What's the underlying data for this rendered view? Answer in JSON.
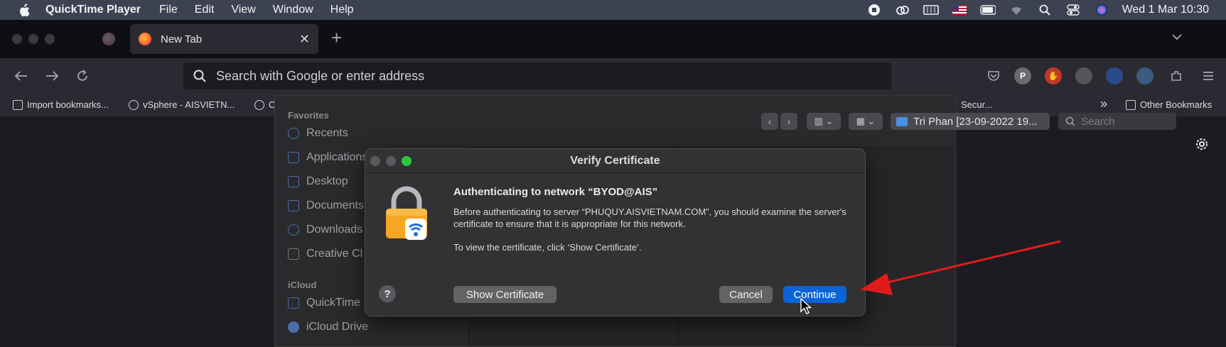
{
  "menubar": {
    "app_name": "QuickTime Player",
    "menus": [
      "File",
      "Edit",
      "View",
      "Window",
      "Help"
    ],
    "clock": "Wed 1 Mar  10:30"
  },
  "browser": {
    "tab_title": "New Tab",
    "new_tab_symbol": "+",
    "close_symbol": "✕",
    "url_placeholder": "Search with Google or enter address",
    "bookmarks": {
      "import": "Import bookmarks...",
      "vsphere": "vSphere - AISVIETN...",
      "c": "C",
      "secur": "Secur...",
      "chevrons": "»",
      "other": "Other Bookmarks"
    }
  },
  "finder": {
    "favorites_heading": "Favorites",
    "favorites": [
      "Recents",
      "Applications",
      "Desktop",
      "Documents",
      "Downloads",
      "Creative Cl"
    ],
    "icloud_heading": "iCloud",
    "icloud": [
      "QuickTime",
      "iCloud Drive"
    ],
    "location": "Tri Phan [23-09-2022 19...",
    "search_placeholder": "Search"
  },
  "dialog": {
    "title": "Verify Certificate",
    "heading": "Authenticating to network “BYOD@AIS”",
    "body1": "Before authenticating to server “PHUQUY.AISVIETNAM.COM”, you should examine the server's certificate to ensure that it is appropriate for this network.",
    "body2": "To view the certificate, click ‘Show Certificate’.",
    "help_label": "?",
    "show_certificate": "Show Certificate",
    "cancel": "Cancel",
    "continue": "Continue"
  },
  "colors": {
    "accent": "#0a64d8",
    "annotation_arrow": "#e01b1b"
  }
}
